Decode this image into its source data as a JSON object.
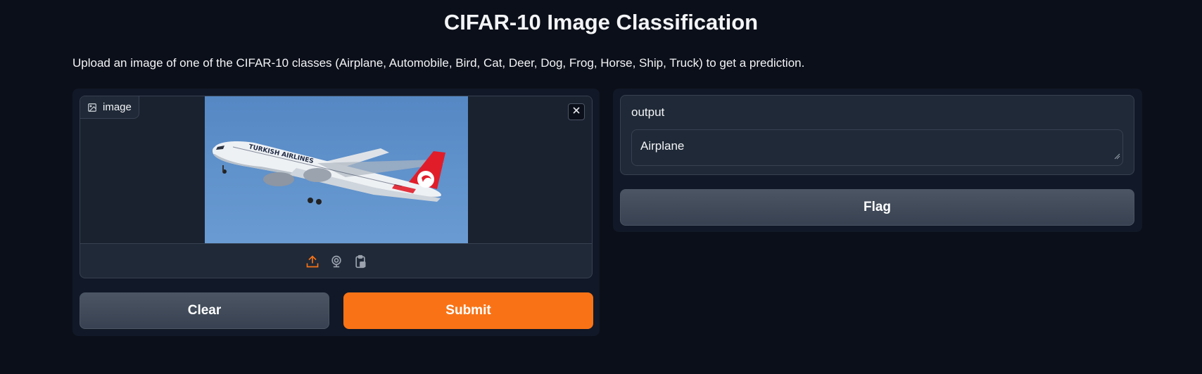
{
  "header": {
    "title": "CIFAR-10 Image Classification",
    "description": "Upload an image of one of the CIFAR-10 classes (Airplane, Automobile, Bird, Cat, Deer, Dog, Frog, Horse, Ship, Truck) to get a prediction."
  },
  "input": {
    "label": "image",
    "label_icon": "image-icon",
    "clear_icon": "close-icon",
    "sources": [
      "upload-icon",
      "webcam-icon",
      "clipboard-icon"
    ],
    "clear_label": "Clear",
    "submit_label": "Submit"
  },
  "output": {
    "label": "output",
    "value": "Airplane",
    "flag_label": "Flag"
  },
  "colors": {
    "background": "#0b0f19",
    "panel": "#111827",
    "block": "#1f2937",
    "border": "#374151",
    "accent": "#f97316",
    "secondary_button": "#4b5563"
  }
}
